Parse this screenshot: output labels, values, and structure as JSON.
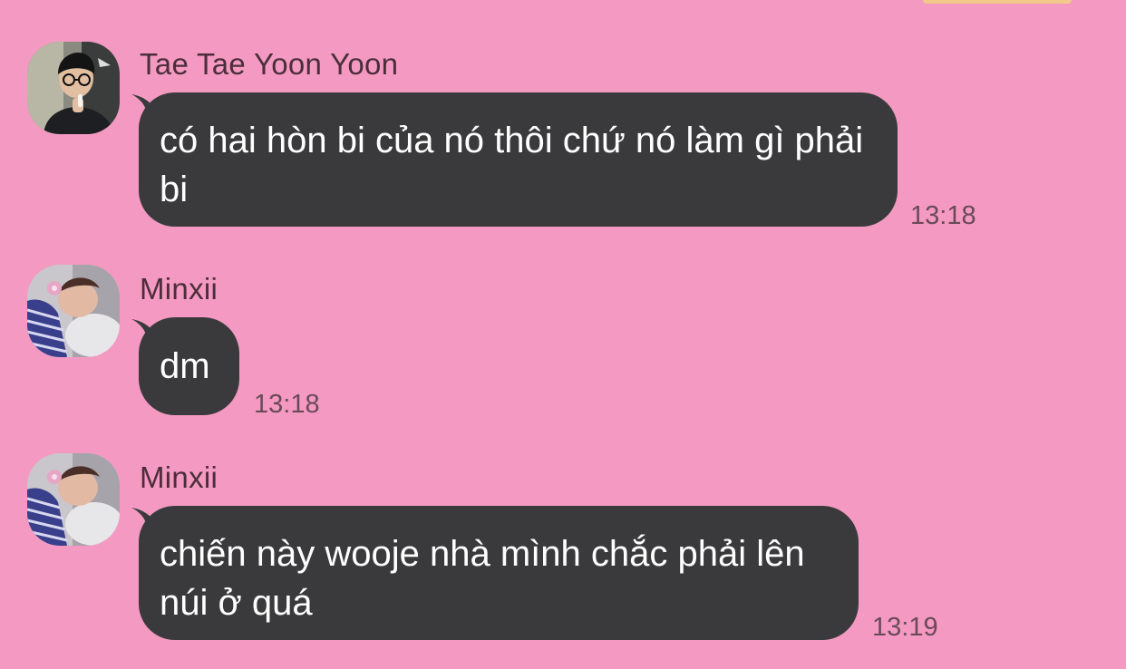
{
  "colors": {
    "background": "#f49ac2",
    "bubble": "#3a3a3c",
    "bubble_text": "#ffffff",
    "sender_text": "#4b2e3a",
    "time_text": "#6a4a58"
  },
  "messages": [
    {
      "sender": "Tae Tae Yoon Yoon",
      "avatar_icon": "avatar-person-glasses",
      "text": "có hai hòn bi của nó thôi chứ nó làm gì phải bi",
      "time": "13:18"
    },
    {
      "sender": "Minxii",
      "avatar_icon": "avatar-person-striped-shirt",
      "text": "dm",
      "time": "13:18"
    },
    {
      "sender": "Minxii",
      "avatar_icon": "avatar-person-striped-shirt",
      "text": "chiến này wooje nhà mình chắc phải lên núi ở quá",
      "time": "13:19"
    }
  ]
}
